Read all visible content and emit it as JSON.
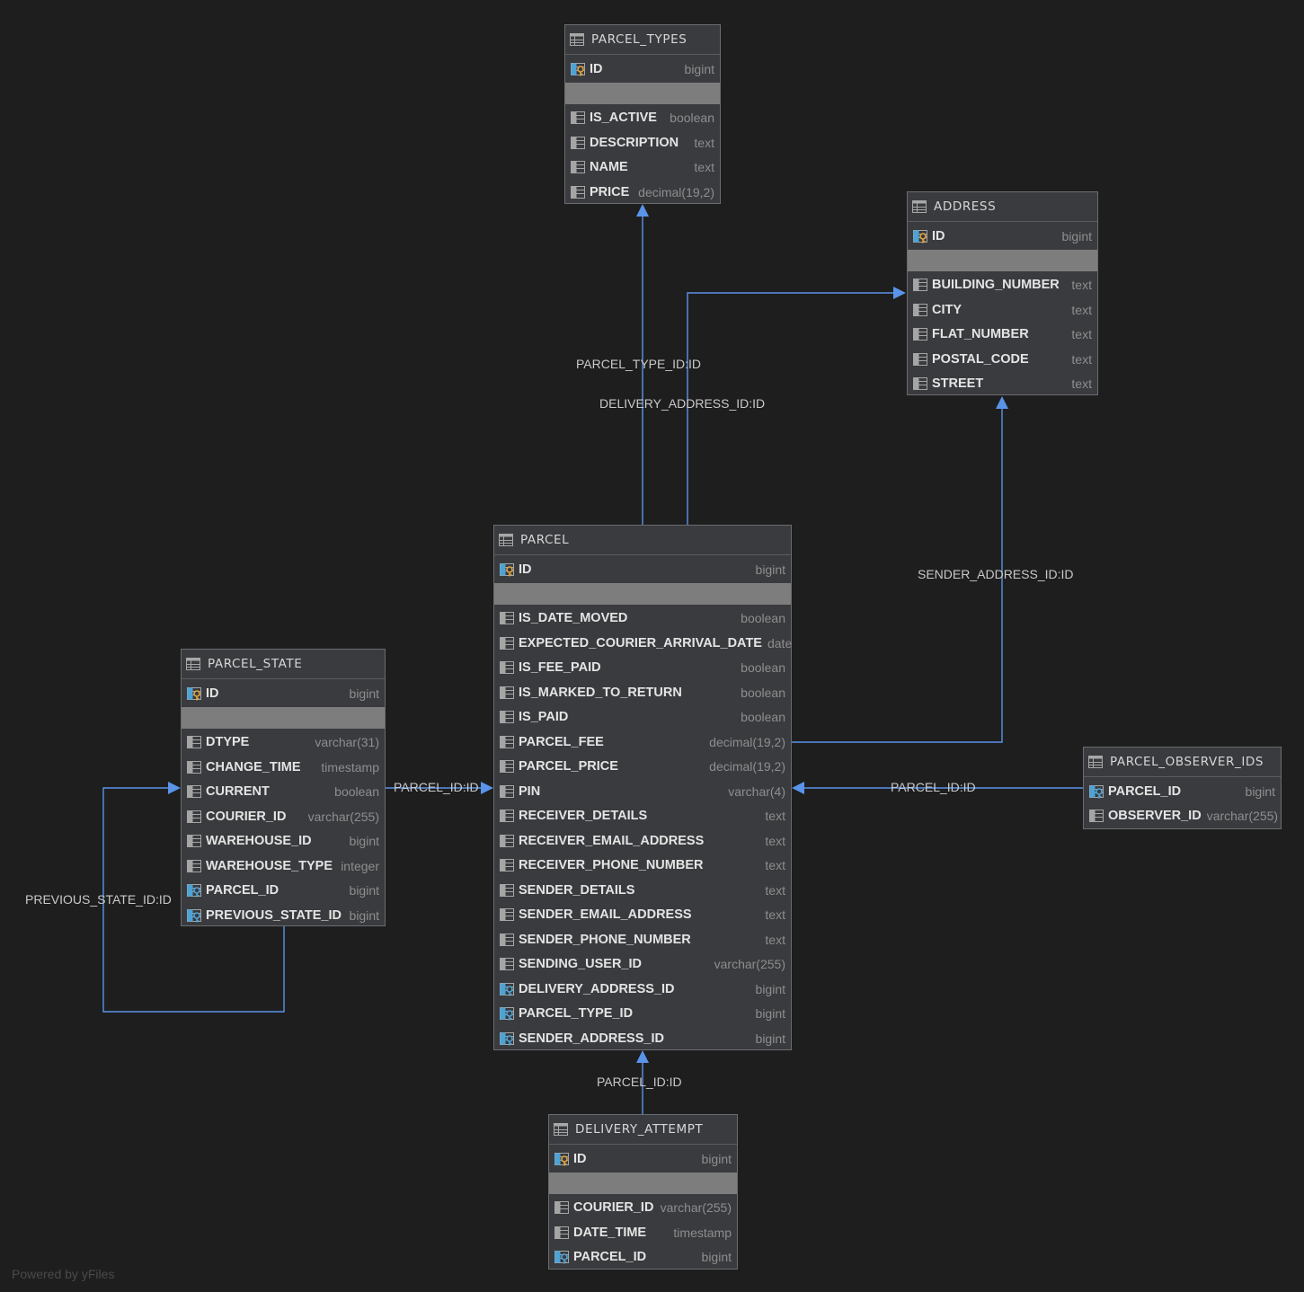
{
  "tables": {
    "parcel_types": {
      "name": "PARCEL_TYPES",
      "columns": [
        {
          "name": "ID",
          "type": "bigint",
          "kind": "pk"
        },
        {
          "name": "IS_ACTIVE",
          "type": "boolean",
          "kind": "col"
        },
        {
          "name": "DESCRIPTION",
          "type": "text",
          "kind": "col"
        },
        {
          "name": "NAME",
          "type": "text",
          "kind": "col"
        },
        {
          "name": "PRICE",
          "type": "decimal(19,2)",
          "kind": "col"
        }
      ]
    },
    "address": {
      "name": "ADDRESS",
      "columns": [
        {
          "name": "ID",
          "type": "bigint",
          "kind": "pk"
        },
        {
          "name": "BUILDING_NUMBER",
          "type": "text",
          "kind": "col"
        },
        {
          "name": "CITY",
          "type": "text",
          "kind": "col"
        },
        {
          "name": "FLAT_NUMBER",
          "type": "text",
          "kind": "col"
        },
        {
          "name": "POSTAL_CODE",
          "type": "text",
          "kind": "col"
        },
        {
          "name": "STREET",
          "type": "text",
          "kind": "col"
        }
      ]
    },
    "parcel": {
      "name": "PARCEL",
      "columns": [
        {
          "name": "ID",
          "type": "bigint",
          "kind": "pk"
        },
        {
          "name": "IS_DATE_MOVED",
          "type": "boolean",
          "kind": "col"
        },
        {
          "name": "EXPECTED_COURIER_ARRIVAL_DATE",
          "type": "date",
          "kind": "col"
        },
        {
          "name": "IS_FEE_PAID",
          "type": "boolean",
          "kind": "col"
        },
        {
          "name": "IS_MARKED_TO_RETURN",
          "type": "boolean",
          "kind": "col"
        },
        {
          "name": "IS_PAID",
          "type": "boolean",
          "kind": "col"
        },
        {
          "name": "PARCEL_FEE",
          "type": "decimal(19,2)",
          "kind": "col"
        },
        {
          "name": "PARCEL_PRICE",
          "type": "decimal(19,2)",
          "kind": "col"
        },
        {
          "name": "PIN",
          "type": "varchar(4)",
          "kind": "col"
        },
        {
          "name": "RECEIVER_DETAILS",
          "type": "text",
          "kind": "col"
        },
        {
          "name": "RECEIVER_EMAIL_ADDRESS",
          "type": "text",
          "kind": "col"
        },
        {
          "name": "RECEIVER_PHONE_NUMBER",
          "type": "text",
          "kind": "col"
        },
        {
          "name": "SENDER_DETAILS",
          "type": "text",
          "kind": "col"
        },
        {
          "name": "SENDER_EMAIL_ADDRESS",
          "type": "text",
          "kind": "col"
        },
        {
          "name": "SENDER_PHONE_NUMBER",
          "type": "text",
          "kind": "col"
        },
        {
          "name": "SENDING_USER_ID",
          "type": "varchar(255)",
          "kind": "col"
        },
        {
          "name": "DELIVERY_ADDRESS_ID",
          "type": "bigint",
          "kind": "fk"
        },
        {
          "name": "PARCEL_TYPE_ID",
          "type": "bigint",
          "kind": "fk"
        },
        {
          "name": "SENDER_ADDRESS_ID",
          "type": "bigint",
          "kind": "fk"
        }
      ]
    },
    "parcel_state": {
      "name": "PARCEL_STATE",
      "columns": [
        {
          "name": "ID",
          "type": "bigint",
          "kind": "pk"
        },
        {
          "name": "DTYPE",
          "type": "varchar(31)",
          "kind": "col"
        },
        {
          "name": "CHANGE_TIME",
          "type": "timestamp",
          "kind": "col"
        },
        {
          "name": "CURRENT",
          "type": "boolean",
          "kind": "col"
        },
        {
          "name": "COURIER_ID",
          "type": "varchar(255)",
          "kind": "col"
        },
        {
          "name": "WAREHOUSE_ID",
          "type": "bigint",
          "kind": "col"
        },
        {
          "name": "WAREHOUSE_TYPE",
          "type": "integer",
          "kind": "col"
        },
        {
          "name": "PARCEL_ID",
          "type": "bigint",
          "kind": "fk"
        },
        {
          "name": "PREVIOUS_STATE_ID",
          "type": "bigint",
          "kind": "fk"
        }
      ]
    },
    "parcel_observer_ids": {
      "name": "PARCEL_OBSERVER_IDS",
      "columns": [
        {
          "name": "PARCEL_ID",
          "type": "bigint",
          "kind": "fk"
        },
        {
          "name": "OBSERVER_ID",
          "type": "varchar(255)",
          "kind": "col"
        }
      ]
    },
    "delivery_attempt": {
      "name": "DELIVERY_ATTEMPT",
      "columns": [
        {
          "name": "ID",
          "type": "bigint",
          "kind": "pk"
        },
        {
          "name": "COURIER_ID",
          "type": "varchar(255)",
          "kind": "col"
        },
        {
          "name": "DATE_TIME",
          "type": "timestamp",
          "kind": "col"
        },
        {
          "name": "PARCEL_ID",
          "type": "bigint",
          "kind": "fk"
        }
      ]
    }
  },
  "relations": {
    "parcel_type": "PARCEL_TYPE_ID:ID",
    "delivery_address": "DELIVERY_ADDRESS_ID:ID",
    "sender_address": "SENDER_ADDRESS_ID:ID",
    "state_parcel": "PARCEL_ID:ID",
    "observer_parcel": "PARCEL_ID:ID",
    "attempt_parcel": "PARCEL_ID:ID",
    "previous_state": "PREVIOUS_STATE_ID:ID"
  },
  "footer": "Powered by yFiles",
  "colors": {
    "background": "#1e1e1f",
    "table_fill": "#393b3e",
    "connector": "#5a94e8",
    "key_gold": "#e2a33c",
    "key_blue": "#4da3d6"
  }
}
